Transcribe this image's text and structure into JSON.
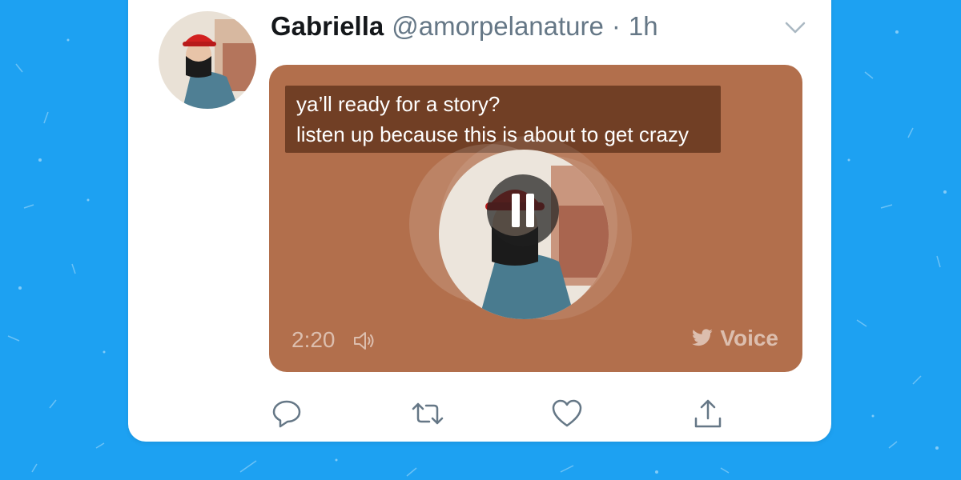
{
  "tweet": {
    "display_name": "Gabriella",
    "handle": "@amorpelanature",
    "separator": "·",
    "time": "1h"
  },
  "voice": {
    "caption_line_1": "ya’ll ready for a story?",
    "caption_line_2": "listen up because this is about to get crazy",
    "duration": "2:20",
    "brand_label": "Voice",
    "playback_state": "playing",
    "card_color": "#B26F4C"
  },
  "actions": [
    {
      "name": "reply",
      "icon": "speech-bubble-icon"
    },
    {
      "name": "retweet",
      "icon": "retweet-icon"
    },
    {
      "name": "like",
      "icon": "heart-icon"
    },
    {
      "name": "share",
      "icon": "share-icon"
    }
  ],
  "colors": {
    "background": "#1DA1F2",
    "name_text": "#14171A",
    "secondary_text": "#657786"
  }
}
